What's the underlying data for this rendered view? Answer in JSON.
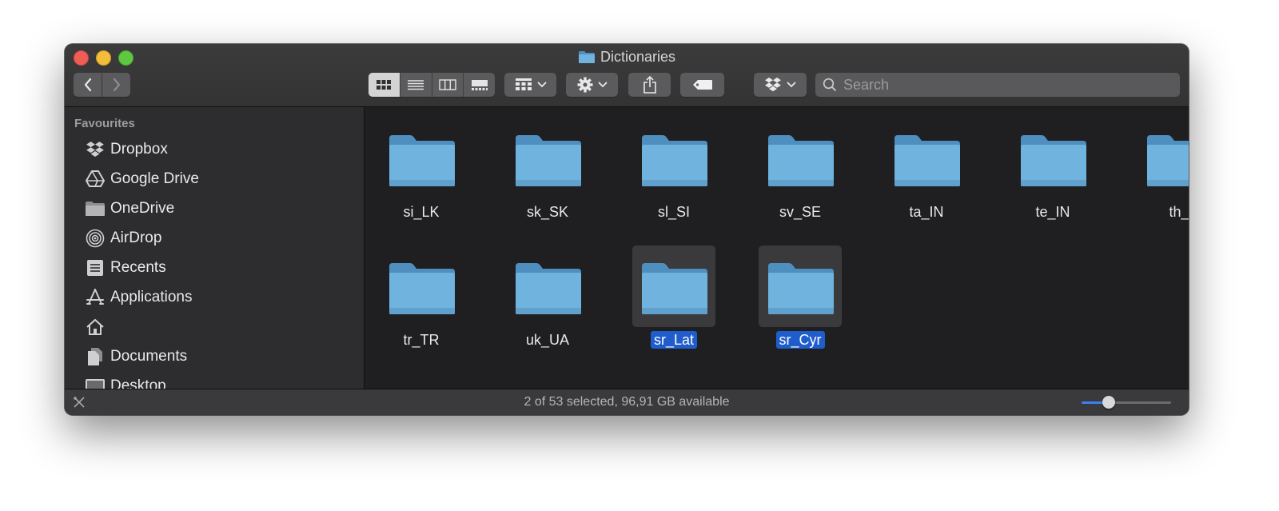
{
  "window": {
    "title": "Dictionaries"
  },
  "toolbar": {
    "back_icon": "chevron-left-icon",
    "forward_icon": "chevron-right-icon",
    "view_modes": [
      "icon-view-icon",
      "list-view-icon",
      "column-view-icon",
      "gallery-view-icon"
    ],
    "active_view": "icon",
    "group_icon": "group-grid-icon",
    "action_icon": "gear-icon",
    "share_icon": "share-icon",
    "tag_icon": "tag-icon",
    "dropbox_icon": "dropbox-icon",
    "search_placeholder": "Search"
  },
  "sidebar": {
    "header": "Favourites",
    "items": [
      {
        "label": "Dropbox",
        "icon": "dropbox-icon"
      },
      {
        "label": "Google Drive",
        "icon": "google-drive-icon"
      },
      {
        "label": "OneDrive",
        "icon": "folder-icon"
      },
      {
        "label": "AirDrop",
        "icon": "airdrop-icon"
      },
      {
        "label": "Recents",
        "icon": "recents-icon"
      },
      {
        "label": "Applications",
        "icon": "applications-icon"
      },
      {
        "label": "",
        "icon": "home-icon"
      },
      {
        "label": "Documents",
        "icon": "documents-icon"
      },
      {
        "label": "Desktop",
        "icon": "desktop-icon"
      }
    ]
  },
  "files": [
    {
      "name": "si_LK",
      "selected": false
    },
    {
      "name": "sk_SK",
      "selected": false
    },
    {
      "name": "sl_SI",
      "selected": false
    },
    {
      "name": "sv_SE",
      "selected": false
    },
    {
      "name": "ta_IN",
      "selected": false
    },
    {
      "name": "te_IN",
      "selected": false
    },
    {
      "name": "th_",
      "selected": false
    },
    {
      "name": "tr_TR",
      "selected": false
    },
    {
      "name": "uk_UA",
      "selected": false
    },
    {
      "name": "sr_Lat",
      "selected": true
    },
    {
      "name": "sr_Cyr",
      "selected": true
    }
  ],
  "status": {
    "text": "2 of 53 selected, 96,91 GB available",
    "icon_size_level": 0.27
  },
  "colors": {
    "folder_front": "#6fb3de",
    "folder_back": "#4e8fbf",
    "selection": "#1f5ccc",
    "slider_accent": "#3d7ff0"
  }
}
